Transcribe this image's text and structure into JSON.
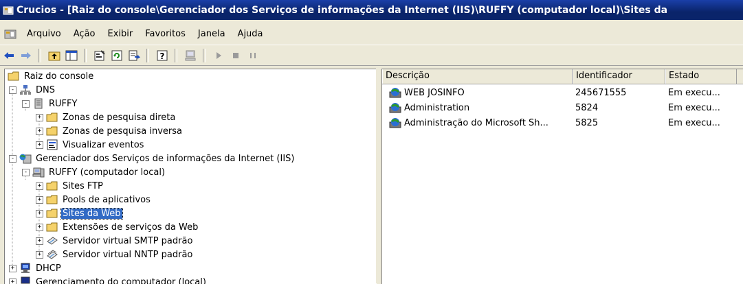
{
  "window": {
    "title": "Crucios - [Raiz do console\\Gerenciador dos Serviços de informações da Internet (IIS)\\RUFFY (computador local)\\Sites da"
  },
  "menu": {
    "items": [
      {
        "label": "Arquivo"
      },
      {
        "label": "Ação"
      },
      {
        "label": "Exibir"
      },
      {
        "label": "Favoritos"
      },
      {
        "label": "Janela"
      },
      {
        "label": "Ajuda"
      }
    ]
  },
  "toolbar": {
    "buttons": [
      "back-icon",
      "forward-icon",
      "up-folder-icon",
      "show-tree-icon",
      "properties-icon",
      "refresh-icon",
      "export-list-icon",
      "help-icon",
      "computer-icon",
      "play-icon",
      "stop-icon",
      "pause-icon"
    ]
  },
  "tree": {
    "items": [
      {
        "label": "Raiz do console",
        "icon": "folder-icon",
        "expander": ""
      },
      {
        "label": "DNS",
        "icon": "dns-icon",
        "expander": "-"
      },
      {
        "label": "RUFFY",
        "icon": "server-icon",
        "expander": "-"
      },
      {
        "label": "Zonas de pesquisa direta",
        "icon": "folder-icon",
        "expander": "+"
      },
      {
        "label": "Zonas de pesquisa inversa",
        "icon": "folder-icon",
        "expander": "+"
      },
      {
        "label": "Visualizar eventos",
        "icon": "event-viewer-icon",
        "expander": "+"
      },
      {
        "label": "Gerenciador dos Serviços de informações da Internet (IIS)",
        "icon": "iis-icon",
        "expander": "-"
      },
      {
        "label": "RUFFY (computador local)",
        "icon": "computer-icon",
        "expander": "-"
      },
      {
        "label": "Sites FTP",
        "icon": "folder-icon",
        "expander": "+"
      },
      {
        "label": "Pools de aplicativos",
        "icon": "folder-icon",
        "expander": "+"
      },
      {
        "label": "Sites da Web",
        "icon": "folder-icon",
        "expander": "+"
      },
      {
        "label": "Extensões de serviços da Web",
        "icon": "folder-icon",
        "expander": "+"
      },
      {
        "label": "Servidor virtual SMTP padrão",
        "icon": "smtp-icon",
        "expander": "+"
      },
      {
        "label": "Servidor virtual NNTP padrão",
        "icon": "nntp-icon",
        "expander": "+"
      },
      {
        "label": "DHCP",
        "icon": "dhcp-icon",
        "expander": "+"
      },
      {
        "label": "Gerenciamento do computador (local)",
        "icon": "computer-management-icon",
        "expander": "+"
      }
    ],
    "selected": "Sites da Web"
  },
  "list": {
    "columns": [
      {
        "label": "Descrição"
      },
      {
        "label": "Identificador"
      },
      {
        "label": "Estado"
      }
    ],
    "rows": [
      {
        "description": "WEB JOSINFO",
        "id": "245671555",
        "state": "Em execu..."
      },
      {
        "description": "Administration",
        "id": "5824",
        "state": "Em execu..."
      },
      {
        "description": "Administração do Microsoft Sh...",
        "id": "5825",
        "state": "Em execu..."
      }
    ]
  },
  "colors": {
    "titlebar": "#0a246a",
    "selection": "#316ac5",
    "face": "#ece9d8"
  }
}
